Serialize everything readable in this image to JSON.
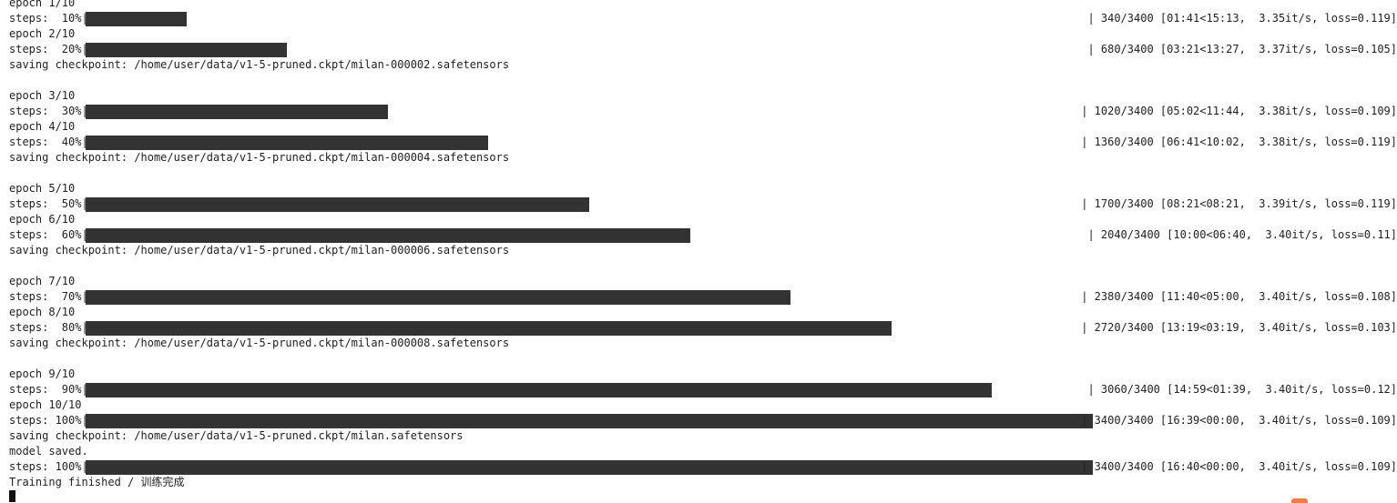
{
  "lines": [
    {
      "kind": "text",
      "text": "epoch 1/10"
    },
    {
      "kind": "bar",
      "prefix": "steps:  10%|",
      "progress": 0.1,
      "suffix": "| 340/3400 [01:41<15:13,  3.35it/s, loss=0.119]"
    },
    {
      "kind": "text",
      "text": "epoch 2/10"
    },
    {
      "kind": "bar",
      "prefix": "steps:  20%|",
      "progress": 0.2,
      "suffix": "| 680/3400 [03:21<13:27,  3.37it/s, loss=0.105]"
    },
    {
      "kind": "text",
      "text": "saving checkpoint: /home/user/data/v1-5-pruned.ckpt/milan-000002.safetensors"
    },
    {
      "kind": "text",
      "text": ""
    },
    {
      "kind": "text",
      "text": "epoch 3/10"
    },
    {
      "kind": "bar",
      "prefix": "steps:  30%|",
      "progress": 0.3,
      "suffix": "| 1020/3400 [05:02<11:44,  3.38it/s, loss=0.109]"
    },
    {
      "kind": "text",
      "text": "epoch 4/10"
    },
    {
      "kind": "bar",
      "prefix": "steps:  40%|",
      "progress": 0.4,
      "suffix": "| 1360/3400 [06:41<10:02,  3.38it/s, loss=0.119]"
    },
    {
      "kind": "text",
      "text": "saving checkpoint: /home/user/data/v1-5-pruned.ckpt/milan-000004.safetensors"
    },
    {
      "kind": "text",
      "text": ""
    },
    {
      "kind": "text",
      "text": "epoch 5/10"
    },
    {
      "kind": "bar",
      "prefix": "steps:  50%|",
      "progress": 0.5,
      "suffix": "| 1700/3400 [08:21<08:21,  3.39it/s, loss=0.119]"
    },
    {
      "kind": "text",
      "text": "epoch 6/10"
    },
    {
      "kind": "bar",
      "prefix": "steps:  60%|",
      "progress": 0.6,
      "suffix": "| 2040/3400 [10:00<06:40,  3.40it/s, loss=0.11]"
    },
    {
      "kind": "text",
      "text": "saving checkpoint: /home/user/data/v1-5-pruned.ckpt/milan-000006.safetensors"
    },
    {
      "kind": "text",
      "text": ""
    },
    {
      "kind": "text",
      "text": "epoch 7/10"
    },
    {
      "kind": "bar",
      "prefix": "steps:  70%|",
      "progress": 0.7,
      "suffix": "| 2380/3400 [11:40<05:00,  3.40it/s, loss=0.108]"
    },
    {
      "kind": "text",
      "text": "epoch 8/10"
    },
    {
      "kind": "bar",
      "prefix": "steps:  80%|",
      "progress": 0.8,
      "suffix": "| 2720/3400 [13:19<03:19,  3.40it/s, loss=0.103]"
    },
    {
      "kind": "text",
      "text": "saving checkpoint: /home/user/data/v1-5-pruned.ckpt/milan-000008.safetensors"
    },
    {
      "kind": "text",
      "text": ""
    },
    {
      "kind": "text",
      "text": "epoch 9/10"
    },
    {
      "kind": "bar",
      "prefix": "steps:  90%|",
      "progress": 0.9,
      "suffix": "| 3060/3400 [14:59<01:39,  3.40it/s, loss=0.12]"
    },
    {
      "kind": "text",
      "text": "epoch 10/10"
    },
    {
      "kind": "bar",
      "prefix": "steps: 100%|",
      "progress": 1.0,
      "suffix": "| 3400/3400 [16:39<00:00,  3.40it/s, loss=0.109]"
    },
    {
      "kind": "text",
      "text": "saving checkpoint: /home/user/data/v1-5-pruned.ckpt/milan.safetensors"
    },
    {
      "kind": "text",
      "text": "model saved."
    },
    {
      "kind": "bar",
      "prefix": "steps: 100%|",
      "progress": 1.0,
      "suffix": "| 3400/3400 [16:40<00:00,  3.40it/s, loss=0.109]"
    },
    {
      "kind": "text",
      "text": "Training finished / 训练完成"
    }
  ],
  "colors": {
    "bar_fill": "#333333",
    "text": "#222222",
    "background": "#ffffff",
    "accent": "#f47c3c"
  }
}
